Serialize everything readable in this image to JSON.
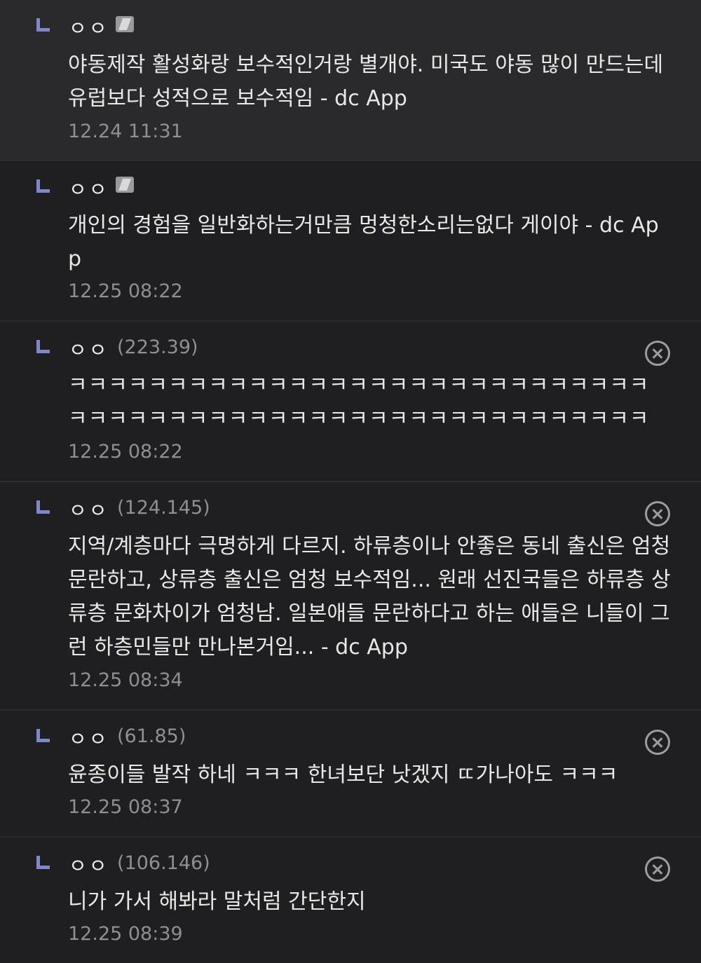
{
  "comments": [
    {
      "author": "ㅇㅇ",
      "ip": "",
      "has_badge": true,
      "body": "야동제작 활성화랑 보수적인거랑 별개야. 미국도 야동 많이 만드는데 유럽보다 성적으로 보수적임 - dc App",
      "date": "12.24 11:31"
    },
    {
      "author": "ㅇㅇ",
      "ip": "",
      "has_badge": true,
      "body": "개인의 경험을 일반화하는거만큼 멍청한소리는없다 게이야 - dc Ap\np",
      "date": "12.25 08:22"
    },
    {
      "author": "ㅇㅇ",
      "ip": "(223.39)",
      "has_badge": false,
      "body": "ㅋㅋㅋㅋㅋㅋㅋㅋㅋㅋㅋㅋㅋㅋㅋㅋㅋㅋㅋㅋㅋㅋㅋㅋㅋㅋㅋㅋㅋ\nㅋㅋㅋㅋㅋㅋㅋㅋㅋㅋㅋㅋㅋㅋㅋㅋㅋㅋㅋㅋㅋㅋㅋㅋㅋㅋㅋㅋㅋ",
      "date": "12.25 08:22"
    },
    {
      "author": "ㅇㅇ",
      "ip": "(124.145)",
      "has_badge": false,
      "body": "지역/계층마다 극명하게 다르지. 하류층이나 안좋은 동네 출신은 엄청 문란하고, 상류층 출신은 엄청 보수적임... 원래 선진국들은 하류층 상류층 문화차이가 엄청남. 일본애들 문란하다고 하는 애들은 니들이 그런 하층민들만 만나본거임... - dc App",
      "date": "12.25 08:34"
    },
    {
      "author": "ㅇㅇ",
      "ip": "(61.85)",
      "has_badge": false,
      "body": "윤종이들 발작 하네 ㅋㅋㅋ 한녀보단 낫겠지 ㄸ가나아도 ㅋㅋㅋ",
      "date": "12.25 08:37"
    },
    {
      "author": "ㅇㅇ",
      "ip": "(106.146)",
      "has_badge": false,
      "body": "니가 가서 해봐라 말처럼 간단한지",
      "date": "12.25 08:39"
    }
  ]
}
